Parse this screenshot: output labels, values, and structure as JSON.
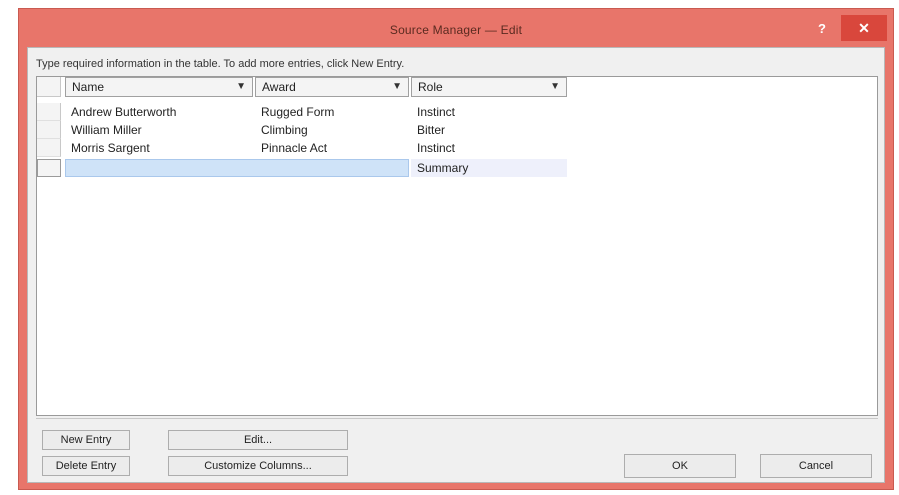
{
  "window": {
    "title": "Source Manager — Edit",
    "help_glyph": "?",
    "close_glyph": "✕"
  },
  "instructions": "Type required information in the table. To add more entries, click New Entry.",
  "grid": {
    "columns": [
      {
        "label": "Name"
      },
      {
        "label": "Award"
      },
      {
        "label": "Role"
      }
    ],
    "rows": [
      {
        "name": "Andrew Butterworth",
        "award": "Rugged Form",
        "role": "Instinct"
      },
      {
        "name": "William Miller",
        "award": "Climbing",
        "role": "Bitter"
      },
      {
        "name": "Morris Sargent",
        "award": "Pinnacle Act",
        "role": "Instinct"
      }
    ],
    "new_row": {
      "role": "Summary"
    },
    "dropdown_glyph": "▼"
  },
  "buttons": {
    "new_entry": "New Entry",
    "delete_entry": "Delete Entry",
    "edit": "Edit...",
    "configure_columns": "Customize Columns...",
    "ok": "OK",
    "cancel": "Cancel"
  },
  "colors": {
    "window_frame": "#e8756a",
    "close_button": "#d9473c",
    "selection": "#cfe3f8"
  }
}
